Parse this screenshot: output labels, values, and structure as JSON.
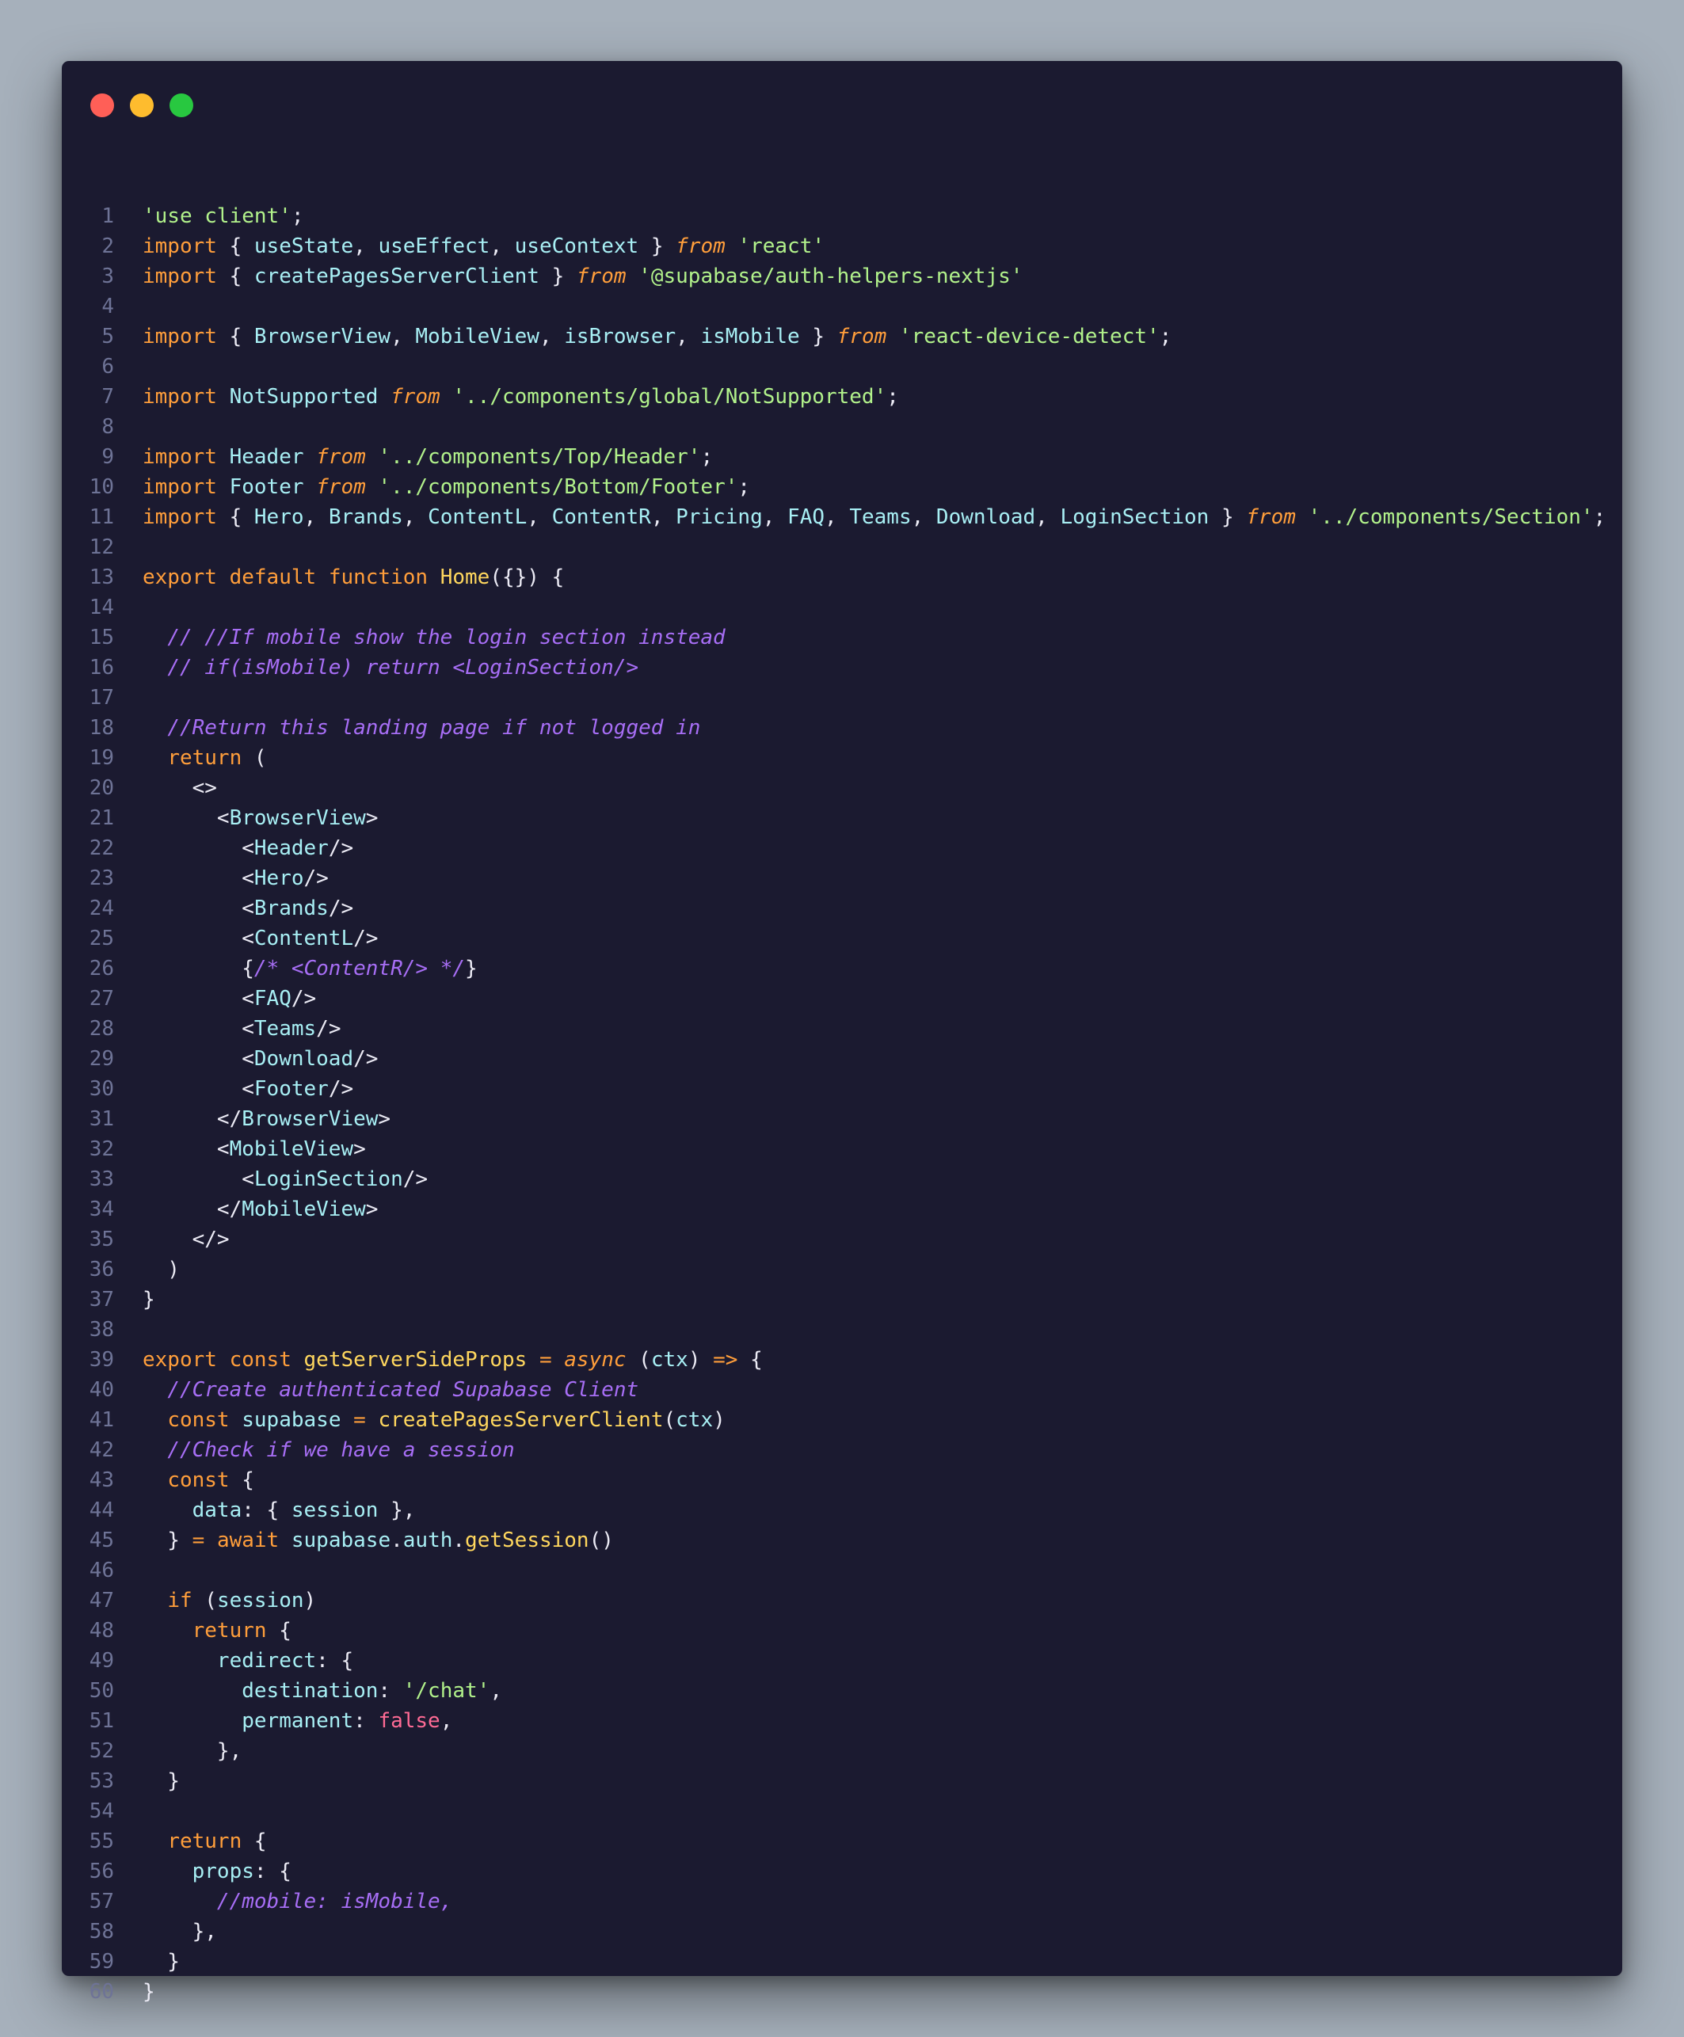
{
  "window": {
    "controls": [
      "close",
      "minimize",
      "maximize"
    ]
  },
  "colors": {
    "background": "#a6b0bb",
    "editor": "#1b1a30",
    "keyword": "#ff9e3b",
    "string": "#b2f28b",
    "identifier": "#a8eff4",
    "function": "#ffd75e",
    "comment": "#a76ef5",
    "boolean": "#ff6b95",
    "line_number": "#6e7396"
  },
  "code": {
    "lines": [
      {
        "n": "1",
        "tokens": [
          [
            "str",
            "'use client'"
          ],
          [
            "pr",
            ";"
          ]
        ]
      },
      {
        "n": "2",
        "tokens": [
          [
            "kw",
            "import"
          ],
          [
            "pr",
            " { "
          ],
          [
            "id",
            "useState"
          ],
          [
            "pr",
            ", "
          ],
          [
            "id",
            "useEffect"
          ],
          [
            "pr",
            ", "
          ],
          [
            "id",
            "useContext"
          ],
          [
            "pr",
            " } "
          ],
          [
            "it",
            "from"
          ],
          [
            "pr",
            " "
          ],
          [
            "str",
            "'react'"
          ]
        ]
      },
      {
        "n": "3",
        "tokens": [
          [
            "kw",
            "import"
          ],
          [
            "pr",
            " { "
          ],
          [
            "id",
            "createPagesServerClient"
          ],
          [
            "pr",
            " } "
          ],
          [
            "it",
            "from"
          ],
          [
            "pr",
            " "
          ],
          [
            "str",
            "'@supabase/auth-helpers-nextjs'"
          ]
        ]
      },
      {
        "n": "4",
        "tokens": []
      },
      {
        "n": "5",
        "tokens": [
          [
            "kw",
            "import"
          ],
          [
            "pr",
            " { "
          ],
          [
            "id",
            "BrowserView"
          ],
          [
            "pr",
            ", "
          ],
          [
            "id",
            "MobileView"
          ],
          [
            "pr",
            ", "
          ],
          [
            "id",
            "isBrowser"
          ],
          [
            "pr",
            ", "
          ],
          [
            "id",
            "isMobile"
          ],
          [
            "pr",
            " } "
          ],
          [
            "it",
            "from"
          ],
          [
            "pr",
            " "
          ],
          [
            "str",
            "'react-device-detect'"
          ],
          [
            "pr",
            ";"
          ]
        ]
      },
      {
        "n": "6",
        "tokens": []
      },
      {
        "n": "7",
        "tokens": [
          [
            "kw",
            "import"
          ],
          [
            "pr",
            " "
          ],
          [
            "id",
            "NotSupported"
          ],
          [
            "pr",
            " "
          ],
          [
            "it",
            "from"
          ],
          [
            "pr",
            " "
          ],
          [
            "str",
            "'../components/global/NotSupported'"
          ],
          [
            "pr",
            ";"
          ]
        ]
      },
      {
        "n": "8",
        "tokens": []
      },
      {
        "n": "9",
        "tokens": [
          [
            "kw",
            "import"
          ],
          [
            "pr",
            " "
          ],
          [
            "id",
            "Header"
          ],
          [
            "pr",
            " "
          ],
          [
            "it",
            "from"
          ],
          [
            "pr",
            " "
          ],
          [
            "str",
            "'../components/Top/Header'"
          ],
          [
            "pr",
            ";"
          ]
        ]
      },
      {
        "n": "10",
        "tokens": [
          [
            "kw",
            "import"
          ],
          [
            "pr",
            " "
          ],
          [
            "id",
            "Footer"
          ],
          [
            "pr",
            " "
          ],
          [
            "it",
            "from"
          ],
          [
            "pr",
            " "
          ],
          [
            "str",
            "'../components/Bottom/Footer'"
          ],
          [
            "pr",
            ";"
          ]
        ]
      },
      {
        "n": "11",
        "tokens": [
          [
            "kw",
            "import"
          ],
          [
            "pr",
            " { "
          ],
          [
            "id",
            "Hero"
          ],
          [
            "pr",
            ", "
          ],
          [
            "id",
            "Brands"
          ],
          [
            "pr",
            ", "
          ],
          [
            "id",
            "ContentL"
          ],
          [
            "pr",
            ", "
          ],
          [
            "id",
            "ContentR"
          ],
          [
            "pr",
            ", "
          ],
          [
            "id",
            "Pricing"
          ],
          [
            "pr",
            ", "
          ],
          [
            "id",
            "FAQ"
          ],
          [
            "pr",
            ", "
          ],
          [
            "id",
            "Teams"
          ],
          [
            "pr",
            ", "
          ],
          [
            "id",
            "Download"
          ],
          [
            "pr",
            ", "
          ],
          [
            "id",
            "LoginSection"
          ],
          [
            "pr",
            " } "
          ],
          [
            "it",
            "from"
          ],
          [
            "pr",
            " "
          ],
          [
            "str",
            "'../components/Section'"
          ],
          [
            "pr",
            ";"
          ]
        ]
      },
      {
        "n": "12",
        "tokens": []
      },
      {
        "n": "13",
        "tokens": [
          [
            "kw",
            "export"
          ],
          [
            "pr",
            " "
          ],
          [
            "kw",
            "default"
          ],
          [
            "pr",
            " "
          ],
          [
            "kw",
            "function"
          ],
          [
            "pr",
            " "
          ],
          [
            "fn",
            "Home"
          ],
          [
            "pr",
            "({}) {"
          ]
        ]
      },
      {
        "n": "14",
        "tokens": []
      },
      {
        "n": "15",
        "tokens": [
          [
            "pr",
            "  "
          ],
          [
            "cm",
            "// //If mobile show the login section instead"
          ]
        ]
      },
      {
        "n": "16",
        "tokens": [
          [
            "pr",
            "  "
          ],
          [
            "cm",
            "// if(isMobile) return <LoginSection/>"
          ]
        ]
      },
      {
        "n": "17",
        "tokens": []
      },
      {
        "n": "18",
        "tokens": [
          [
            "pr",
            "  "
          ],
          [
            "cm",
            "//Return this landing page if not logged in"
          ]
        ]
      },
      {
        "n": "19",
        "tokens": [
          [
            "pr",
            "  "
          ],
          [
            "kw",
            "return"
          ],
          [
            "pr",
            " ("
          ]
        ]
      },
      {
        "n": "20",
        "tokens": [
          [
            "pr",
            "    <>"
          ]
        ]
      },
      {
        "n": "21",
        "tokens": [
          [
            "pr",
            "      <"
          ],
          [
            "id",
            "BrowserView"
          ],
          [
            "pr",
            ">"
          ]
        ]
      },
      {
        "n": "22",
        "tokens": [
          [
            "pr",
            "        <"
          ],
          [
            "id",
            "Header"
          ],
          [
            "pr",
            "/>"
          ]
        ]
      },
      {
        "n": "23",
        "tokens": [
          [
            "pr",
            "        <"
          ],
          [
            "id",
            "Hero"
          ],
          [
            "pr",
            "/>"
          ]
        ]
      },
      {
        "n": "24",
        "tokens": [
          [
            "pr",
            "        <"
          ],
          [
            "id",
            "Brands"
          ],
          [
            "pr",
            "/>"
          ]
        ]
      },
      {
        "n": "25",
        "tokens": [
          [
            "pr",
            "        <"
          ],
          [
            "id",
            "ContentL"
          ],
          [
            "pr",
            "/>"
          ]
        ]
      },
      {
        "n": "26",
        "tokens": [
          [
            "pr",
            "        {"
          ],
          [
            "cm",
            "/* <ContentR/> */"
          ],
          [
            "pr",
            "}"
          ]
        ]
      },
      {
        "n": "27",
        "tokens": [
          [
            "pr",
            "        <"
          ],
          [
            "id",
            "FAQ"
          ],
          [
            "pr",
            "/>"
          ]
        ]
      },
      {
        "n": "28",
        "tokens": [
          [
            "pr",
            "        <"
          ],
          [
            "id",
            "Teams"
          ],
          [
            "pr",
            "/>"
          ]
        ]
      },
      {
        "n": "29",
        "tokens": [
          [
            "pr",
            "        <"
          ],
          [
            "id",
            "Download"
          ],
          [
            "pr",
            "/>"
          ]
        ]
      },
      {
        "n": "30",
        "tokens": [
          [
            "pr",
            "        <"
          ],
          [
            "id",
            "Footer"
          ],
          [
            "pr",
            "/>"
          ]
        ]
      },
      {
        "n": "31",
        "tokens": [
          [
            "pr",
            "      </"
          ],
          [
            "id",
            "BrowserView"
          ],
          [
            "pr",
            ">"
          ]
        ]
      },
      {
        "n": "32",
        "tokens": [
          [
            "pr",
            "      <"
          ],
          [
            "id",
            "MobileView"
          ],
          [
            "pr",
            ">"
          ]
        ]
      },
      {
        "n": "33",
        "tokens": [
          [
            "pr",
            "        <"
          ],
          [
            "id",
            "LoginSection"
          ],
          [
            "pr",
            "/>"
          ]
        ]
      },
      {
        "n": "34",
        "tokens": [
          [
            "pr",
            "      </"
          ],
          [
            "id",
            "MobileView"
          ],
          [
            "pr",
            ">"
          ]
        ]
      },
      {
        "n": "35",
        "tokens": [
          [
            "pr",
            "    </>"
          ]
        ]
      },
      {
        "n": "36",
        "tokens": [
          [
            "pr",
            "  )"
          ]
        ]
      },
      {
        "n": "37",
        "tokens": [
          [
            "pr",
            "}"
          ]
        ]
      },
      {
        "n": "38",
        "tokens": []
      },
      {
        "n": "39",
        "tokens": [
          [
            "kw",
            "export"
          ],
          [
            "pr",
            " "
          ],
          [
            "kw",
            "const"
          ],
          [
            "pr",
            " "
          ],
          [
            "fn",
            "getServerSideProps"
          ],
          [
            "pr",
            " "
          ],
          [
            "kw",
            "="
          ],
          [
            "pr",
            " "
          ],
          [
            "it",
            "async"
          ],
          [
            "pr",
            " ("
          ],
          [
            "id",
            "ctx"
          ],
          [
            "pr",
            ") "
          ],
          [
            "kw",
            "=>"
          ],
          [
            "pr",
            " {"
          ]
        ]
      },
      {
        "n": "40",
        "tokens": [
          [
            "pr",
            "  "
          ],
          [
            "cm",
            "//Create authenticated Supabase Client"
          ]
        ]
      },
      {
        "n": "41",
        "tokens": [
          [
            "pr",
            "  "
          ],
          [
            "kw",
            "const"
          ],
          [
            "pr",
            " "
          ],
          [
            "id",
            "supabase"
          ],
          [
            "pr",
            " "
          ],
          [
            "kw",
            "="
          ],
          [
            "pr",
            " "
          ],
          [
            "fn",
            "createPagesServerClient"
          ],
          [
            "pr",
            "("
          ],
          [
            "id",
            "ctx"
          ],
          [
            "pr",
            ")"
          ]
        ]
      },
      {
        "n": "42",
        "tokens": [
          [
            "pr",
            "  "
          ],
          [
            "cm",
            "//Check if we have a session"
          ]
        ]
      },
      {
        "n": "43",
        "tokens": [
          [
            "pr",
            "  "
          ],
          [
            "kw",
            "const"
          ],
          [
            "pr",
            " {"
          ]
        ]
      },
      {
        "n": "44",
        "tokens": [
          [
            "pr",
            "    "
          ],
          [
            "id",
            "data"
          ],
          [
            "pr",
            ": { "
          ],
          [
            "id",
            "session"
          ],
          [
            "pr",
            " },"
          ]
        ]
      },
      {
        "n": "45",
        "tokens": [
          [
            "pr",
            "  } "
          ],
          [
            "kw",
            "="
          ],
          [
            "pr",
            " "
          ],
          [
            "kw",
            "await"
          ],
          [
            "pr",
            " "
          ],
          [
            "id",
            "supabase"
          ],
          [
            "pr",
            "."
          ],
          [
            "id",
            "auth"
          ],
          [
            "pr",
            "."
          ],
          [
            "fn",
            "getSession"
          ],
          [
            "pr",
            "()"
          ]
        ]
      },
      {
        "n": "46",
        "tokens": []
      },
      {
        "n": "47",
        "tokens": [
          [
            "pr",
            "  "
          ],
          [
            "kw",
            "if"
          ],
          [
            "pr",
            " ("
          ],
          [
            "id",
            "session"
          ],
          [
            "pr",
            ")"
          ]
        ]
      },
      {
        "n": "48",
        "tokens": [
          [
            "pr",
            "    "
          ],
          [
            "kw",
            "return"
          ],
          [
            "pr",
            " {"
          ]
        ]
      },
      {
        "n": "49",
        "tokens": [
          [
            "pr",
            "      "
          ],
          [
            "id",
            "redirect"
          ],
          [
            "pr",
            ": {"
          ]
        ]
      },
      {
        "n": "50",
        "tokens": [
          [
            "pr",
            "        "
          ],
          [
            "id",
            "destination"
          ],
          [
            "pr",
            ": "
          ],
          [
            "str",
            "'/chat'"
          ],
          [
            "pr",
            ","
          ]
        ]
      },
      {
        "n": "51",
        "tokens": [
          [
            "pr",
            "        "
          ],
          [
            "id",
            "permanent"
          ],
          [
            "pr",
            ": "
          ],
          [
            "bl",
            "false"
          ],
          [
            "pr",
            ","
          ]
        ]
      },
      {
        "n": "52",
        "tokens": [
          [
            "pr",
            "      },"
          ]
        ]
      },
      {
        "n": "53",
        "tokens": [
          [
            "pr",
            "  }"
          ]
        ]
      },
      {
        "n": "54",
        "tokens": []
      },
      {
        "n": "55",
        "tokens": [
          [
            "pr",
            "  "
          ],
          [
            "kw",
            "return"
          ],
          [
            "pr",
            " {"
          ]
        ]
      },
      {
        "n": "56",
        "tokens": [
          [
            "pr",
            "    "
          ],
          [
            "id",
            "props"
          ],
          [
            "pr",
            ": {"
          ]
        ]
      },
      {
        "n": "57",
        "tokens": [
          [
            "pr",
            "      "
          ],
          [
            "cm",
            "//mobile: isMobile,"
          ]
        ]
      },
      {
        "n": "58",
        "tokens": [
          [
            "pr",
            "    },"
          ]
        ]
      },
      {
        "n": "59",
        "tokens": [
          [
            "pr",
            "  }"
          ]
        ]
      },
      {
        "n": "60",
        "tokens": [
          [
            "pr",
            "}"
          ]
        ]
      }
    ]
  }
}
